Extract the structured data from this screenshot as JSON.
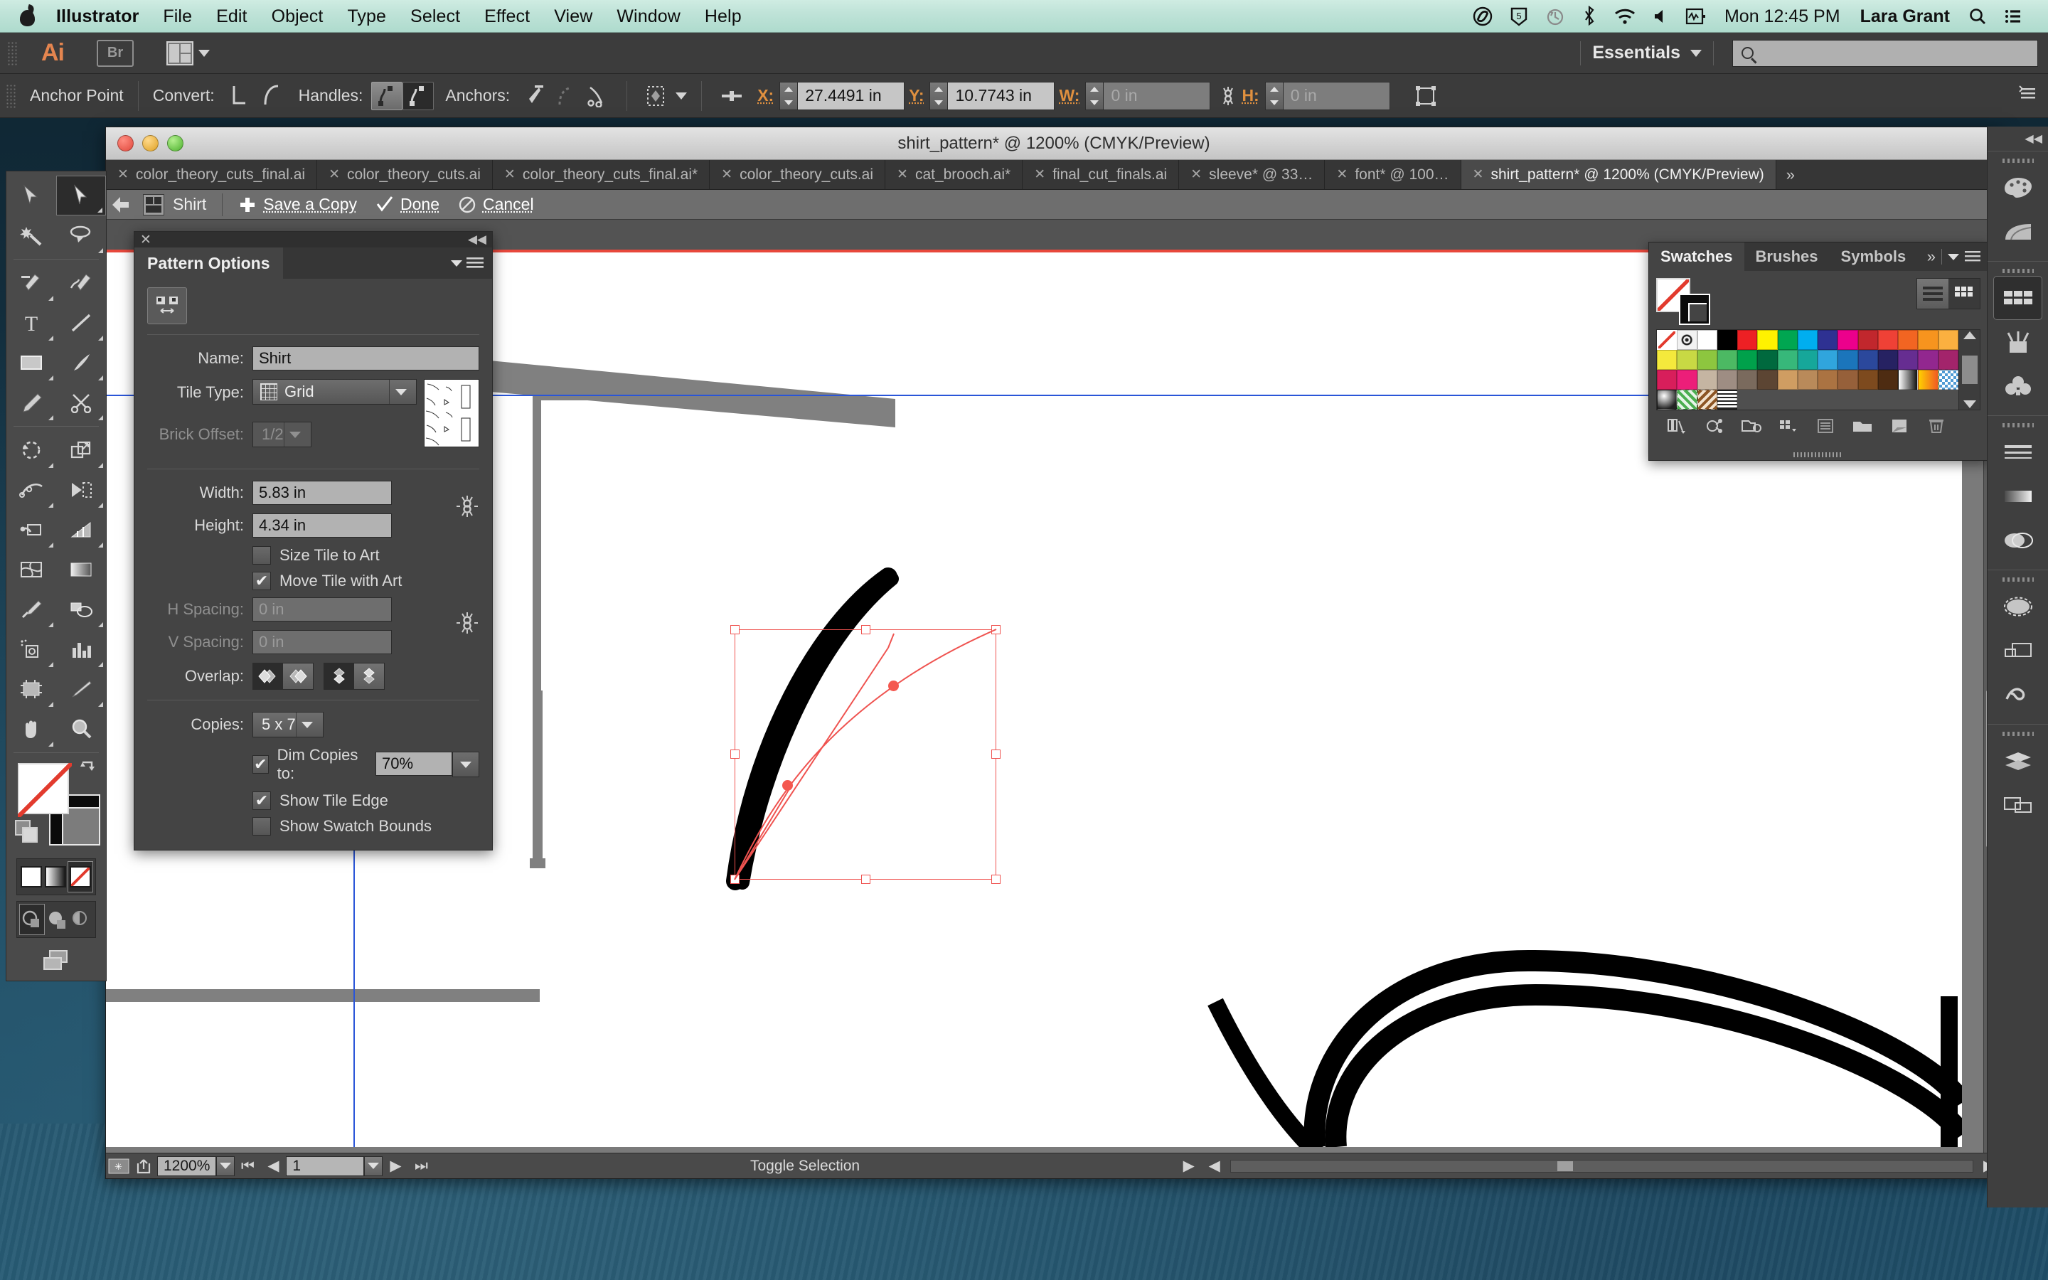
{
  "menubar": {
    "apple_icon": "apple-icon",
    "app": "Illustrator",
    "items": [
      "File",
      "Edit",
      "Object",
      "Type",
      "Select",
      "Effect",
      "View",
      "Window",
      "Help"
    ],
    "status_icons": [
      "creative-cloud-icon",
      "dropbox-icon",
      "time-machine-icon",
      "bluetooth-icon",
      "wifi-icon",
      "volume-icon",
      "activity-monitor-icon"
    ],
    "clock": "Mon 12:45 PM",
    "user": "Lara Grant",
    "search_icon": "spotlight-search-icon",
    "list_icon": "notification-center-icon"
  },
  "appbar": {
    "logo": "Ai",
    "bridge_label": "Br",
    "arrange_icon": "arrange-documents-icon",
    "workspace": "Essentials",
    "workspace_caret": "chevron-down-icon",
    "search_placeholder": "",
    "search_value": "",
    "search_icon": "search-icon"
  },
  "controlbar": {
    "context_label": "Anchor Point",
    "convert_label": "Convert:",
    "handles_label": "Handles:",
    "anchors_label": "Anchors:",
    "x_label": "X:",
    "x_value": "27.4491 in",
    "y_label": "Y:",
    "y_value": "10.7743 in",
    "w_label": "W:",
    "w_value": "0 in",
    "h_label": "H:",
    "h_value": "0 in",
    "link_icon": "broken-link-icon",
    "transform_icon": "transform-icon",
    "align_icon": "align-icon",
    "isolate_icon": "isolate-selected-icon"
  },
  "document": {
    "title": "shirt_pattern* @ 1200% (CMYK/Preview)",
    "tabs": [
      {
        "label": "color_theory_cuts_final.ai",
        "active": false
      },
      {
        "label": "color_theory_cuts.ai",
        "active": false
      },
      {
        "label": "color_theory_cuts_final.ai*",
        "active": false
      },
      {
        "label": "color_theory_cuts.ai",
        "active": false
      },
      {
        "label": "cat_brooch.ai*",
        "active": false
      },
      {
        "label": "final_cut_finals.ai",
        "active": false
      },
      {
        "label": "sleeve* @ 33…",
        "active": false
      },
      {
        "label": "font* @ 100…",
        "active": false
      },
      {
        "label": "shirt_pattern* @ 1200% (CMYK/Preview)",
        "active": true
      }
    ],
    "tabs_overflow": "»"
  },
  "pattern_edit_bar": {
    "back_icon": "back-arrow-icon",
    "swatch_icon": "pattern-swatch-icon",
    "pattern_name": "Shirt",
    "save_copy_icon": "plus-icon",
    "save_copy": "Save a Copy",
    "done_icon": "check-icon",
    "done": "Done",
    "cancel_icon": "no-entry-icon",
    "cancel": "Cancel"
  },
  "pattern_options": {
    "panel_title": "Pattern Options",
    "menu_icon": "panel-menu-icon",
    "tile_tool_icon": "pattern-tile-tool-icon",
    "name_label": "Name:",
    "name_value": "Shirt",
    "tile_type_label": "Tile Type:",
    "tile_type_value": "Grid",
    "tile_type_icon": "grid-icon",
    "brick_offset_label": "Brick Offset:",
    "brick_offset_value": "1/2",
    "brick_offset_disabled": true,
    "width_label": "Width:",
    "width_value": "5.83 in",
    "height_label": "Height:",
    "height_value": "4.34 in",
    "link_dims_icon": "constrain-proportions-icon",
    "size_tile_to_art_label": "Size Tile to Art",
    "size_tile_to_art_checked": false,
    "move_tile_with_art_label": "Move Tile with Art",
    "move_tile_with_art_checked": true,
    "h_spacing_label": "H Spacing:",
    "h_spacing_value": "0 in",
    "v_spacing_label": "V Spacing:",
    "v_spacing_value": "0 in",
    "link_spacing_icon": "constrain-spacing-icon",
    "overlap_label": "Overlap:",
    "overlap_options": [
      "left-in-front-icon",
      "right-in-front-icon",
      "bottom-in-front-icon",
      "top-in-front-icon"
    ],
    "copies_label": "Copies:",
    "copies_value": "5 x 7",
    "dim_copies_label": "Dim Copies to:",
    "dim_copies_checked": true,
    "dim_copies_value": "70%",
    "show_tile_edge_label": "Show Tile Edge",
    "show_tile_edge_checked": true,
    "show_swatch_bounds_label": "Show Swatch Bounds",
    "show_swatch_bounds_checked": false,
    "checkmark": "✔"
  },
  "swatches": {
    "tabs": [
      {
        "label": "Swatches",
        "active": true
      },
      {
        "label": "Brushes",
        "active": false
      },
      {
        "label": "Symbols",
        "active": false
      }
    ],
    "expand_icon": "expand-panels-icon",
    "menu_icon": "panel-menu-icon",
    "fill_swatch": "none-swatch",
    "stroke_swatch": "black-stroke-swatch",
    "view_list_icon": "list-view-icon",
    "view_grid_icon": "grid-view-icon",
    "colors": [
      "none",
      "registration",
      "#ffffff",
      "#000000",
      "#ed2024",
      "#fff200",
      "#00a651",
      "#00aeef",
      "#2e3192",
      "#ec008c",
      "#c1272d",
      "#ef4136",
      "#f26522",
      "#f7941e",
      "#fbb040",
      "#f4e93c",
      "#c8d944",
      "#8dc63f",
      "#4cb963",
      "#00a14b",
      "#00693e",
      "#37b87a",
      "#16a79a",
      "#30a5dd",
      "#1b75bb",
      "#2b489c",
      "#262262",
      "#662d91",
      "#92278f",
      "#a3246b",
      "#d81e5b",
      "#ec1e79",
      "#c5b5a2",
      "#9e8d83",
      "#7a6a5d",
      "#5c4533",
      "#cf9d62",
      "#b98a5a",
      "#ab7342",
      "#96603a",
      "#7d4a1e",
      "#4e2c12",
      "gradient-white-black",
      "gradient-yellow-orange",
      "pattern-blue-check"
    ],
    "extra_swatches": [
      "pattern-sphere",
      "pattern-green-floral",
      "pattern-brown-scroll",
      "pattern-text"
    ],
    "footer_icons": [
      "swatch-libraries-icon",
      "color-group-link-icon",
      "open-library-icon",
      "show-kind-icon",
      "swatch-options-icon",
      "new-color-group-icon",
      "new-swatch-icon",
      "delete-swatch-icon"
    ]
  },
  "statusbar": {
    "artboard_icon": "artboard-icon",
    "share_icon": "share-icon",
    "zoom": "1200%",
    "first_icon": "first-page-icon",
    "prev_icon": "prev-page-icon",
    "page": "1",
    "next_icon": "next-page-icon",
    "last_icon": "last-page-icon",
    "status_text": "Toggle Selection",
    "status_caret": "chevron-right-icon",
    "scroll_left_icon": "scroll-left-icon",
    "scroll_right_icon": "scroll-right-icon"
  },
  "tools": {
    "items": [
      "selection-tool",
      "direct-selection-tool",
      "magic-wand-tool",
      "lasso-tool",
      "pen-tool",
      "curvature-tool",
      "type-tool",
      "line-segment-tool",
      "rectangle-tool",
      "paintbrush-tool",
      "pencil-tool",
      "scissors-tool",
      "rotate-tool",
      "scale-tool",
      "width-tool",
      "free-transform-tool",
      "shape-builder-tool",
      "perspective-grid-tool",
      "mesh-tool",
      "gradient-tool",
      "eyedropper-tool",
      "blend-tool",
      "symbol-sprayer-tool",
      "column-graph-tool",
      "artboard-tool",
      "slice-tool",
      "hand-tool",
      "zoom-tool"
    ],
    "active_tool": "direct-selection-tool",
    "fill_label": "fill-swatch",
    "stroke_label": "stroke-swatch",
    "swap_icon": "swap-fill-stroke-icon",
    "default_icon": "default-fill-stroke-icon",
    "mode_icons": [
      "color-mode-icon",
      "gradient-mode-icon",
      "none-mode-icon"
    ],
    "screen_mode_icon": "change-screen-mode-icon"
  },
  "dock": {
    "collapse_icon": "collapse-panels-icon",
    "groups": [
      [
        "color-panel-icon",
        "color-guide-panel-icon"
      ],
      [
        "swatches-panel-icon",
        "brushes-panel-icon",
        "symbols-panel-icon"
      ],
      [
        "stroke-panel-icon",
        "gradient-panel-icon",
        "transparency-panel-icon"
      ],
      [
        "appearance-panel-icon",
        "graphic-styles-panel-icon",
        "creative-cloud-panel-icon"
      ],
      [
        "layers-panel-icon",
        "artboards-panel-icon"
      ]
    ],
    "active": "swatches-panel-icon"
  },
  "canvas": {
    "zoom_percent": "1200%",
    "selection": {
      "x_in": "27.4491 in",
      "y_in": "10.7743 in",
      "w_in": "0 in",
      "h_in": "0 in"
    }
  }
}
